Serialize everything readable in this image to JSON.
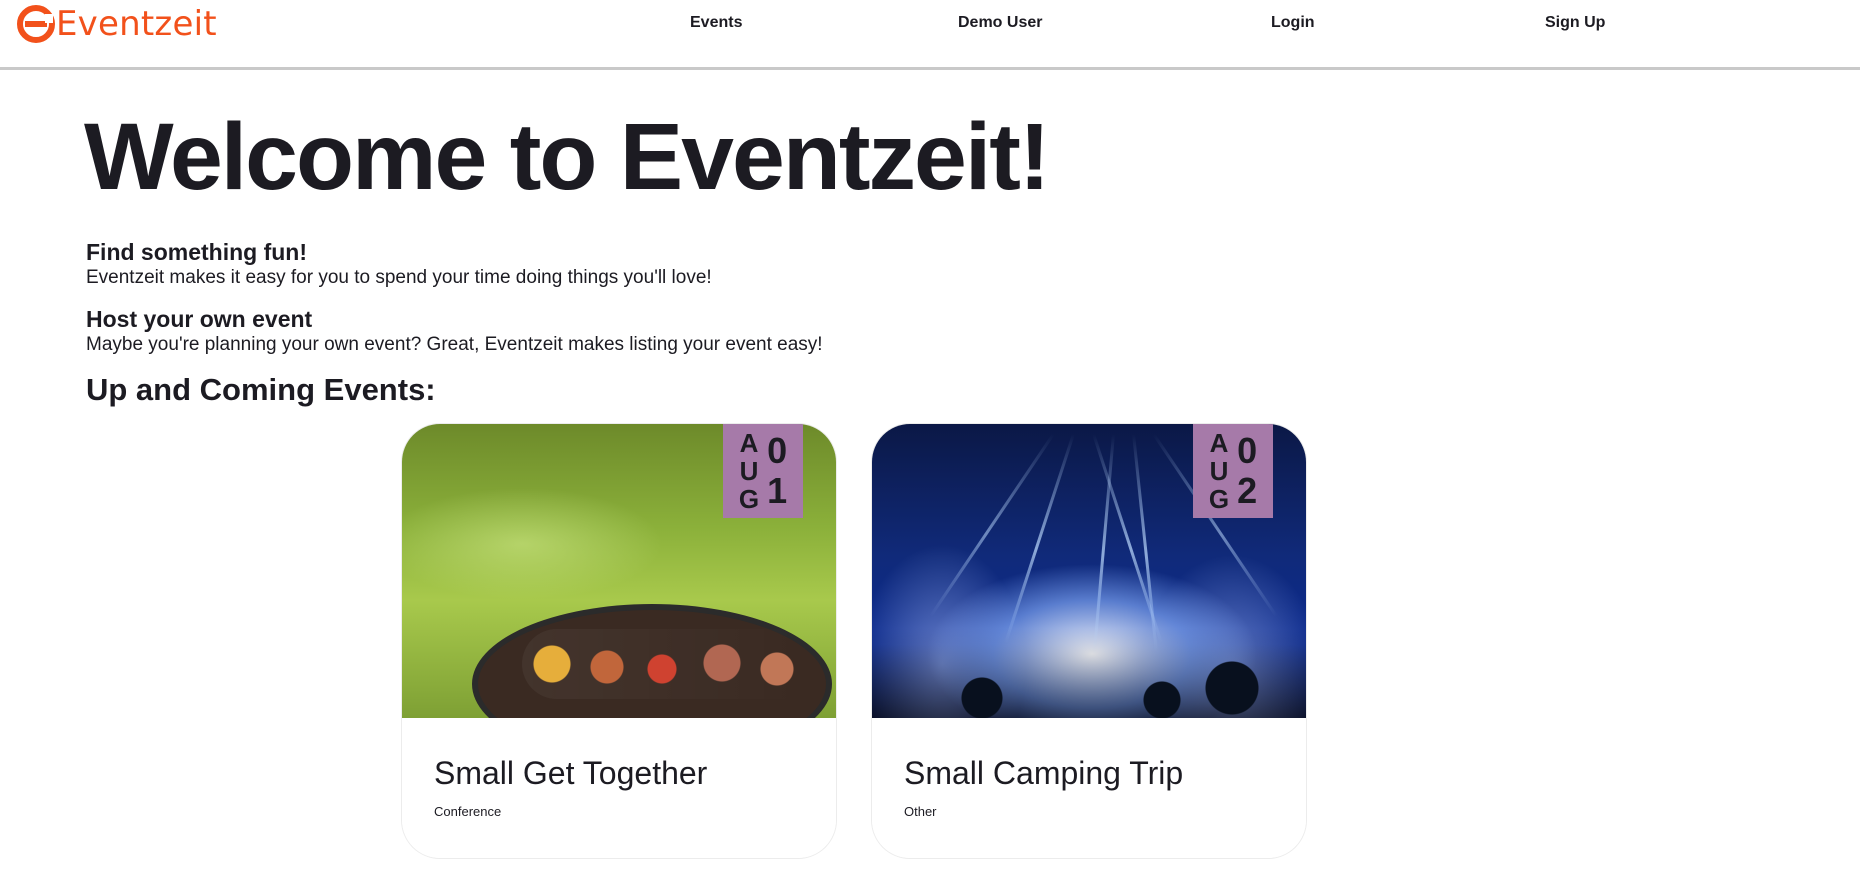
{
  "header": {
    "brand": "Eventzeit",
    "nav": {
      "events": "Events",
      "demo_user": "Demo User",
      "login": "Login",
      "sign_up": "Sign Up"
    }
  },
  "main": {
    "hero_title": "Welcome to Eventzeit!",
    "info": [
      {
        "heading": "Find something fun!",
        "text": "Eventzeit makes it easy for you to spend your time doing things you'll love!"
      },
      {
        "heading": "Host your own event",
        "text": "Maybe you're planning your own event? Great, Eventzeit makes listing your event easy!"
      }
    ],
    "section_title": "Up and Coming Events:",
    "events": [
      {
        "month_letters": [
          "A",
          "U",
          "G"
        ],
        "day_digits": [
          "0",
          "1"
        ],
        "title": "Small Get Together",
        "category": "Conference",
        "image": "bbq-grill-image"
      },
      {
        "month_letters": [
          "A",
          "U",
          "G"
        ],
        "day_digits": [
          "0",
          "2"
        ],
        "title": "Small Camping Trip",
        "category": "Other",
        "image": "concert-lights-image"
      }
    ]
  },
  "colors": {
    "brand": "#f2511b",
    "text": "#1c1b22",
    "date_badge": "#a67aa9",
    "header_border": "#c9c9c9"
  }
}
